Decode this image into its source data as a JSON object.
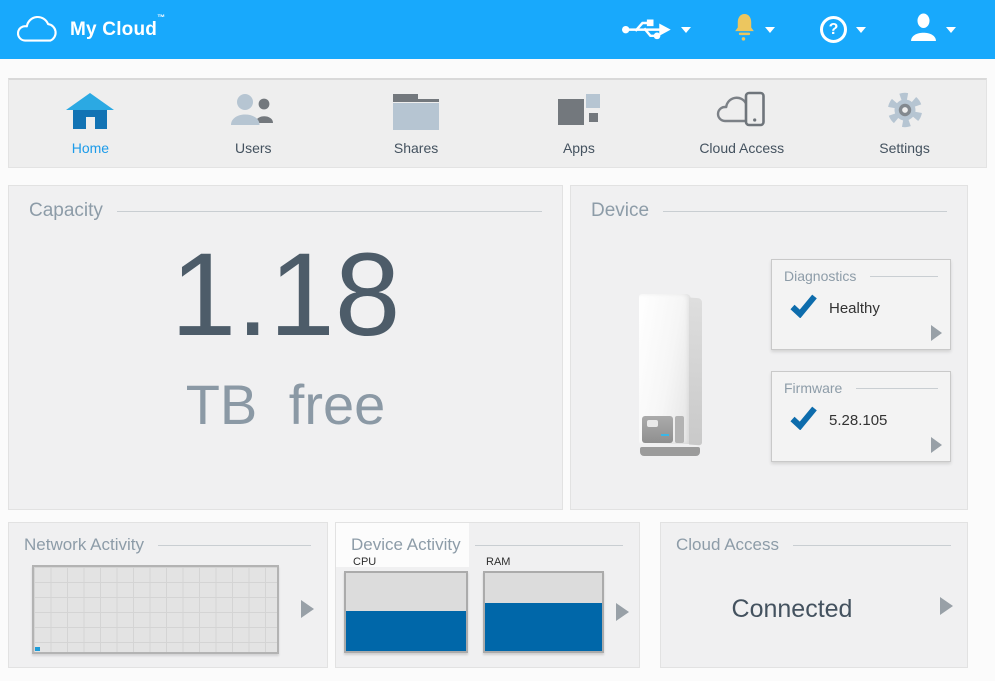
{
  "header": {
    "app_title": "My Cloud",
    "trademark": "™",
    "help_glyph": "?",
    "icons": [
      "usb-icon",
      "bell-icon",
      "help-icon",
      "user-icon"
    ]
  },
  "nav": {
    "items": [
      {
        "label": "Home",
        "active": true
      },
      {
        "label": "Users",
        "active": false
      },
      {
        "label": "Shares",
        "active": false
      },
      {
        "label": "Apps",
        "active": false
      },
      {
        "label": "Cloud Access",
        "active": false
      },
      {
        "label": "Settings",
        "active": false
      }
    ]
  },
  "capacity": {
    "title": "Capacity",
    "value": "1.18",
    "unit": "TB free"
  },
  "device": {
    "title": "Device",
    "diagnostics": {
      "title": "Diagnostics",
      "status": "Healthy"
    },
    "firmware": {
      "title": "Firmware",
      "version": "5.28.105"
    }
  },
  "network_activity": {
    "title": "Network Activity"
  },
  "device_activity": {
    "title": "Device Activity",
    "gauges": [
      {
        "label": "CPU",
        "percent": 51
      },
      {
        "label": "RAM",
        "percent": 61
      }
    ]
  },
  "cloud_access": {
    "title": "Cloud Access",
    "status": "Connected"
  },
  "colors": {
    "header_bg": "#18a9fc",
    "bell_yellow": "#ecc65f",
    "gauge_blue": "#0067a9",
    "check_blue": "#0d6cac",
    "active_nav_blue": "#1c9be9",
    "value_dark": "#4d5c69",
    "label_gray": "#8d9ca8"
  }
}
